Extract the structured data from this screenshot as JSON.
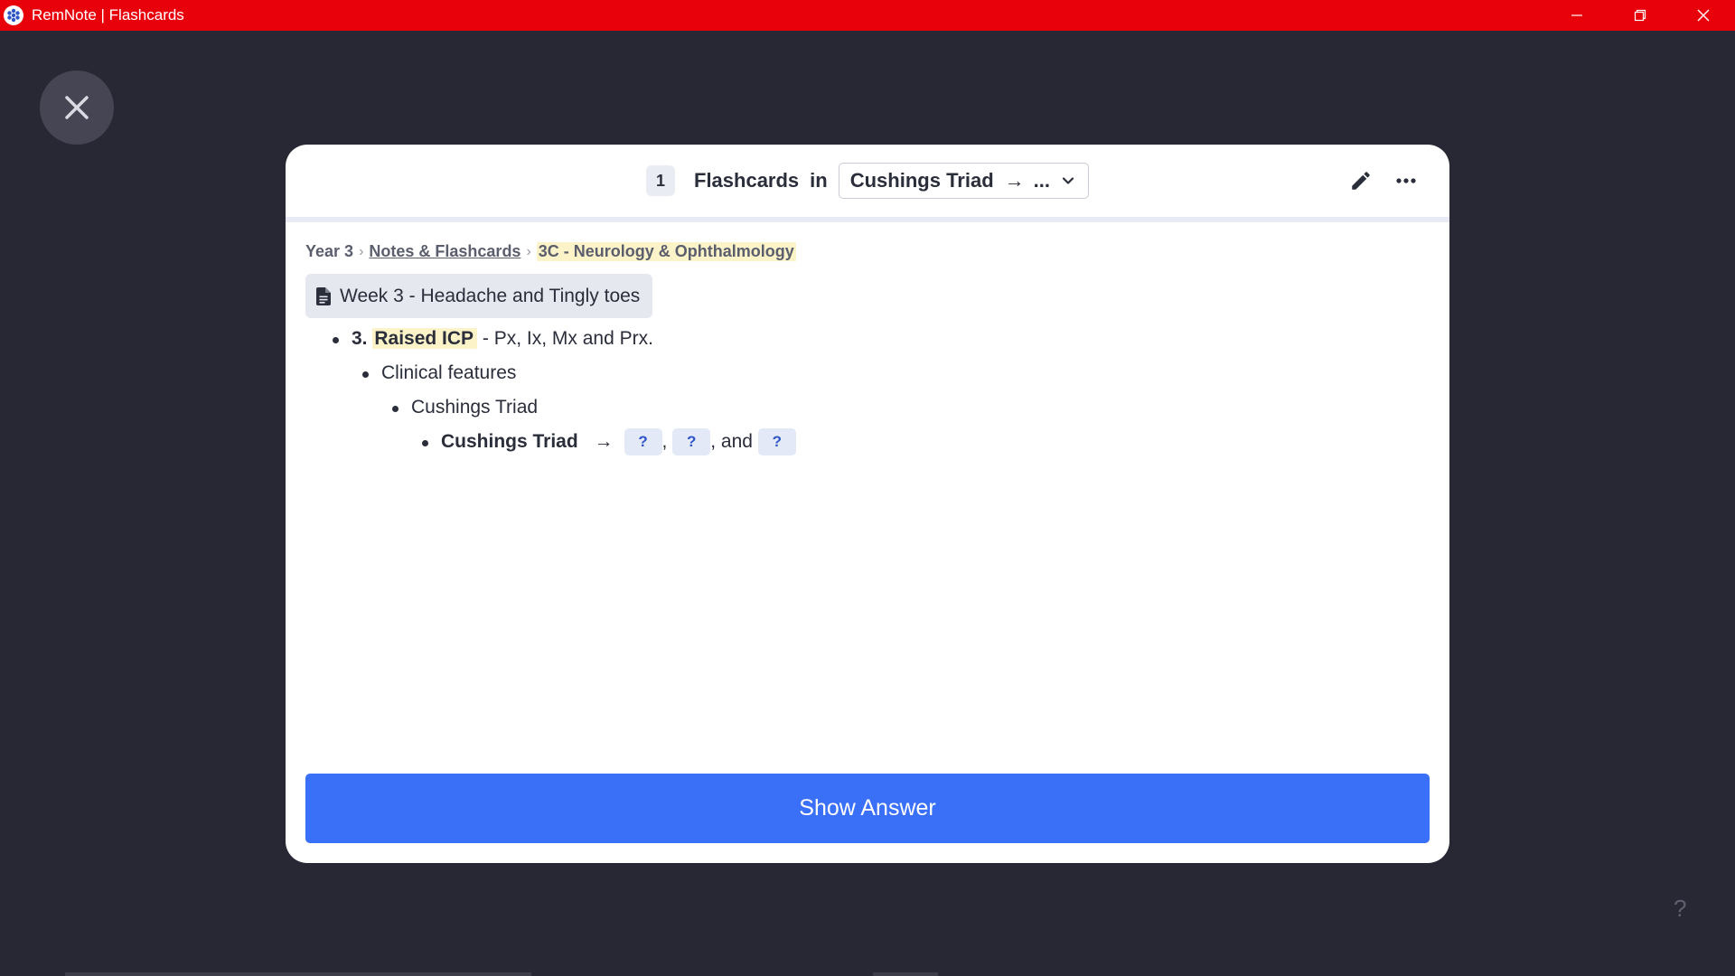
{
  "window": {
    "title": "RemNote | Flashcards",
    "controls": [
      "minimize-icon",
      "restore-icon",
      "close-icon"
    ]
  },
  "header": {
    "count": "1",
    "flashcards_label": "Flashcards",
    "in_label": "in",
    "scope": "Cushings Triad",
    "scope_arrow": "→",
    "scope_more": "...",
    "tools": [
      "pencil-icon",
      "more-icon"
    ]
  },
  "breadcrumb": {
    "year": "Year 3",
    "sep1": "›",
    "notes": "Notes & Flashcards",
    "sep2": "›",
    "module": "3C - Neurology & Ophthalmology"
  },
  "document": {
    "title": "Week 3 - Headache and Tingly toes"
  },
  "tree": {
    "item0_num": "3.",
    "item0_highlight": "Raised ICP",
    "item0_rest": " - Px, Ix, Mx and Prx.",
    "item1": "Clinical features",
    "item2": "Cushings Triad",
    "item3_label": "Cushings Triad",
    "item3_arrow": "→",
    "cloze1": "?",
    "comma1": ",",
    "cloze2": "?",
    "and_text": ", and",
    "cloze3": "?"
  },
  "actions": {
    "show_answer": "Show Answer"
  },
  "help": "?",
  "colors": {
    "titlebar": "#e8000b",
    "background": "#272833",
    "primary_button": "#3a6ff7",
    "highlight": "#fdf3c8",
    "cloze_bg": "#e3e9f7"
  }
}
